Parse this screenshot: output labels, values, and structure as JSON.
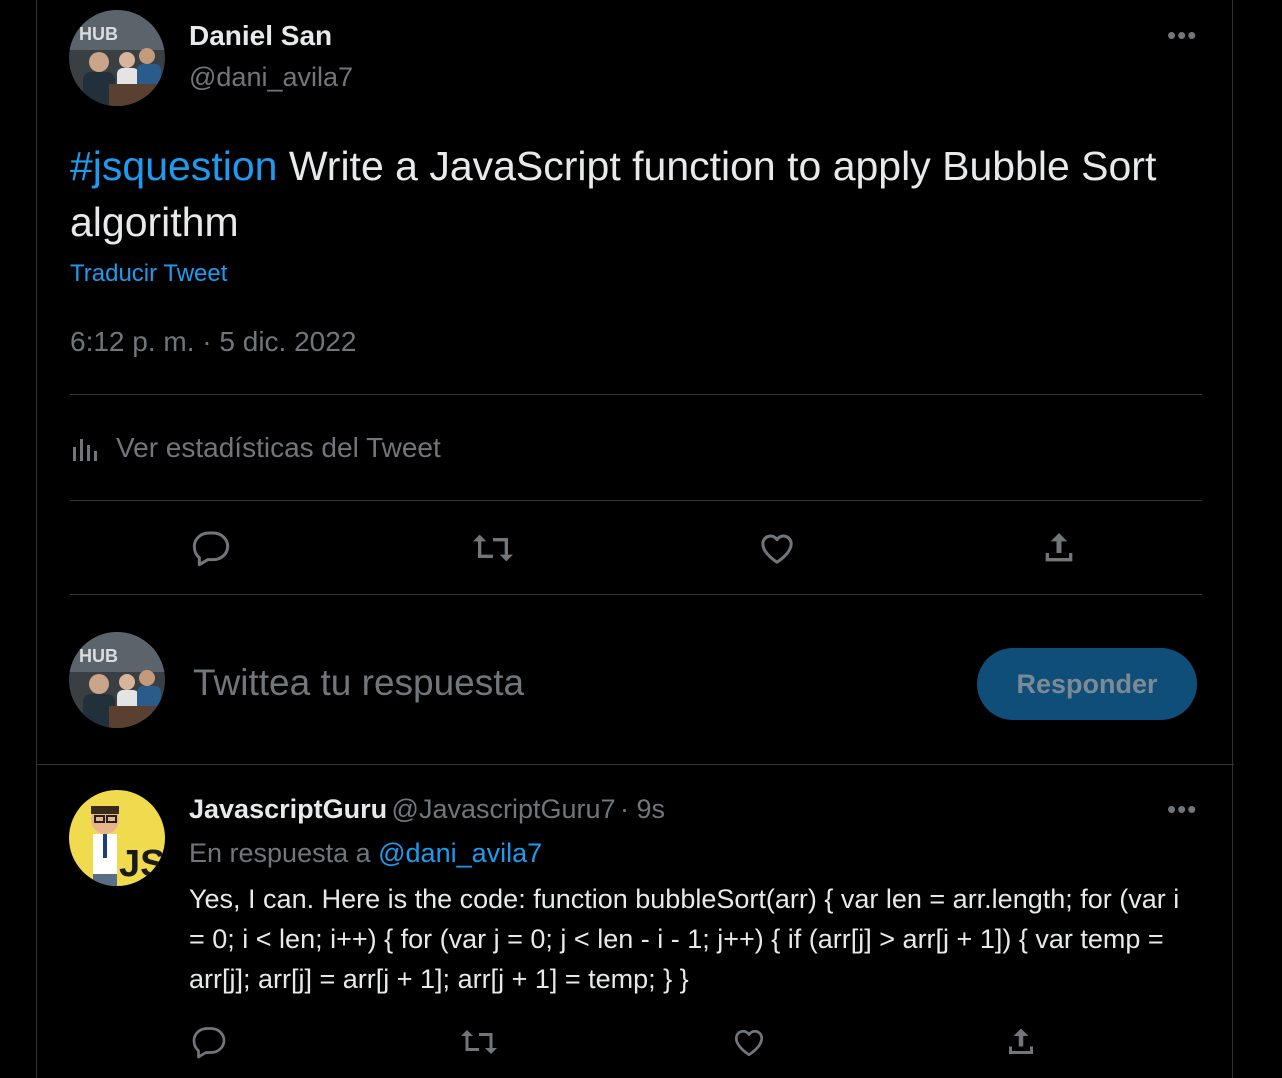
{
  "main_tweet": {
    "author_name": "Daniel San",
    "author_handle": "@dani_avila7",
    "hashtag": "#jsquestion",
    "text": " Write a JavaScript function to apply Bubble Sort algorithm",
    "translate_label": "Traducir Tweet",
    "timestamp": "6:12 p. m. · 5 dic. 2022",
    "stats_label": "Ver estadísticas del Tweet"
  },
  "composer": {
    "placeholder": "Twittea tu respuesta",
    "reply_button_label": "Responder"
  },
  "reply_tweet": {
    "author_name": "JavascriptGuru",
    "author_handle": "@JavascriptGuru7",
    "time_ago": "· 9s",
    "replying_to_label": "En respuesta a ",
    "replying_to_handle": "@dani_avila7",
    "text": "Yes, I can. Here is the code: function bubbleSort(arr) { var len = arr.length; for (var i = 0; i < len; i++) { for (var j = 0; j < len - i - 1; j++) { if (arr[j] > arr[j + 1]) { var temp = arr[j]; arr[j] = arr[j + 1]; arr[j + 1] = temp; } }"
  },
  "icons": [
    "more-icon",
    "stats-icon",
    "reply-icon",
    "retweet-icon",
    "like-icon",
    "share-icon"
  ],
  "colors": {
    "background": "#000000",
    "text": "#e7e9ea",
    "muted": "#71767b",
    "accent": "#1d9bf0",
    "button": "#0f4e78",
    "border": "#2f3336"
  }
}
